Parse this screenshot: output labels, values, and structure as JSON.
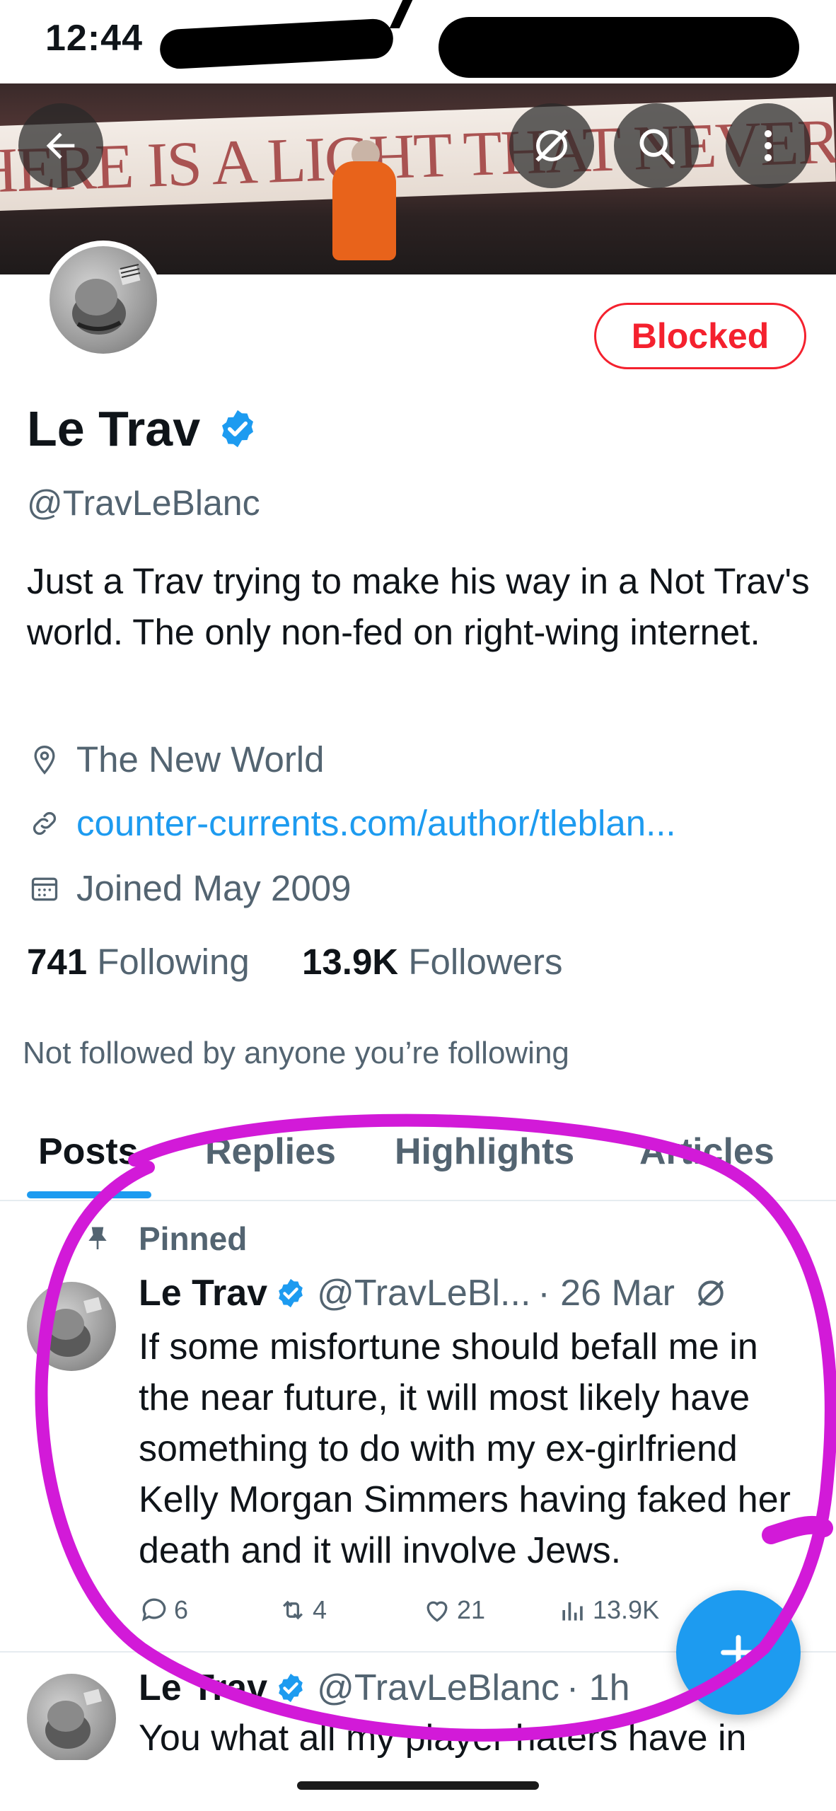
{
  "status_bar": {
    "time": "12:44"
  },
  "banner": {
    "sign_text": "HERE IS A LIGHT THAT NEVER GOES OUT"
  },
  "header_buttons": {
    "back": "back-arrow-icon",
    "grok": "grok-icon",
    "search": "search-icon",
    "more": "more-vertical-icon"
  },
  "profile": {
    "blocked_label": "Blocked",
    "display_name": "Le Trav",
    "handle": "@TravLeBlanc",
    "bio": "Just a Trav trying to make his way in a Not Trav's world.  The only non-fed on right-wing internet.",
    "location": "The New World",
    "website": "counter-currents.com/author/tleblan...",
    "joined": "Joined May 2009",
    "following_count": "741",
    "following_label": "Following",
    "followers_count": "13.9K",
    "followers_label": "Followers",
    "not_followed": "Not followed by anyone you’re following"
  },
  "tabs": [
    {
      "label": "Posts"
    },
    {
      "label": "Replies"
    },
    {
      "label": "Highlights"
    },
    {
      "label": "Articles"
    }
  ],
  "posts": [
    {
      "pinned_label": "Pinned",
      "name": "Le Trav",
      "handle": "@TravLeBl...",
      "time": "· 26 Mar",
      "text": "If some misfortune should befall me in the near future, it will most likely have something to do with my ex-girlfriend Kelly Morgan Simmers having faked her death and it will involve Jews.",
      "replies": "6",
      "reposts": "4",
      "likes": "21",
      "views": "13.9K"
    },
    {
      "name": "Le Trav",
      "handle": "@TravLeBlanc",
      "time": "· 1h",
      "text": "You what all my player haters have in"
    }
  ],
  "colors": {
    "accent": "#1d9bf0",
    "blocked": "#f4212e",
    "annotation": "#d21ad8"
  }
}
